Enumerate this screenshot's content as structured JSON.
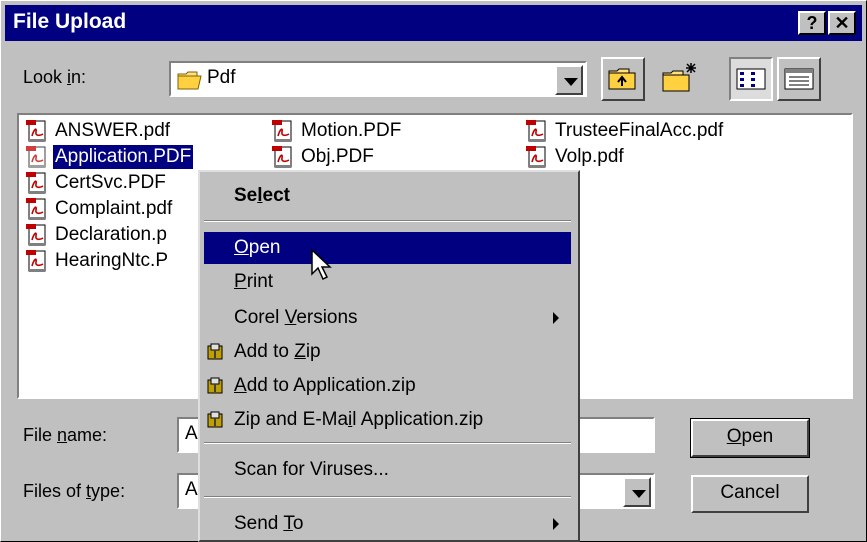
{
  "window": {
    "title": "File Upload",
    "help_label": "?",
    "close_label": "✕"
  },
  "lookin": {
    "label_pre": "Look ",
    "label_key": "i",
    "label_post": "n:",
    "value": "Pdf"
  },
  "toolbar": {
    "icons": [
      "up-folder-icon",
      "new-folder-icon",
      "list-view-icon",
      "details-view-icon"
    ]
  },
  "files": [
    {
      "name": "ANSWER.pdf",
      "selected": false
    },
    {
      "name": "Application.PDF",
      "selected": true
    },
    {
      "name": "CertSvc.PDF",
      "selected": false
    },
    {
      "name": "Complaint.pdf",
      "selected": false
    },
    {
      "name": "Declaration.p",
      "selected": false
    },
    {
      "name": "HearingNtc.P",
      "selected": false
    },
    {
      "name": "Motion.PDF",
      "selected": false
    },
    {
      "name": "Obj.PDF",
      "selected": false
    },
    {
      "name": "TrusteeFinalAcc.pdf",
      "selected": false
    },
    {
      "name": "Volp.pdf",
      "selected": false
    }
  ],
  "filename": {
    "label_pre": "File ",
    "label_key": "n",
    "label_post": "ame:",
    "value": "A"
  },
  "filetype": {
    "label_pre": "Files of ",
    "label_key": "t",
    "label_post": "ype:",
    "value": "A"
  },
  "buttons": {
    "open_key": "O",
    "open_rest": "pen",
    "cancel": "Cancel"
  },
  "context_menu": {
    "items": [
      {
        "pre": "Se",
        "key": "l",
        "post": "ect",
        "bold": true
      },
      {
        "pre": "",
        "key": "O",
        "post": "pen",
        "highlighted": true
      },
      {
        "pre": "",
        "key": "P",
        "post": "rint"
      },
      {
        "pre": "Corel ",
        "key": "V",
        "post": "ersions",
        "submenu": true
      },
      {
        "pre": "Add to ",
        "key": "Z",
        "post": "ip",
        "zip_icon": true
      },
      {
        "pre": "",
        "key": "A",
        "post": "dd to Application.zip",
        "zip_icon": true
      },
      {
        "pre": "Zip and E-Ma",
        "key": "i",
        "post": "l Application.zip",
        "zip_icon": true
      },
      {
        "pre": "Scan for Viruses...",
        "key": "",
        "post": ""
      },
      {
        "pre": "Send ",
        "key": "T",
        "post": "o",
        "submenu": true
      }
    ]
  },
  "colors": {
    "face": "#c0c0c0",
    "titlebar": "#000080",
    "highlight": "#000080",
    "pdf_red": "#c00000"
  }
}
